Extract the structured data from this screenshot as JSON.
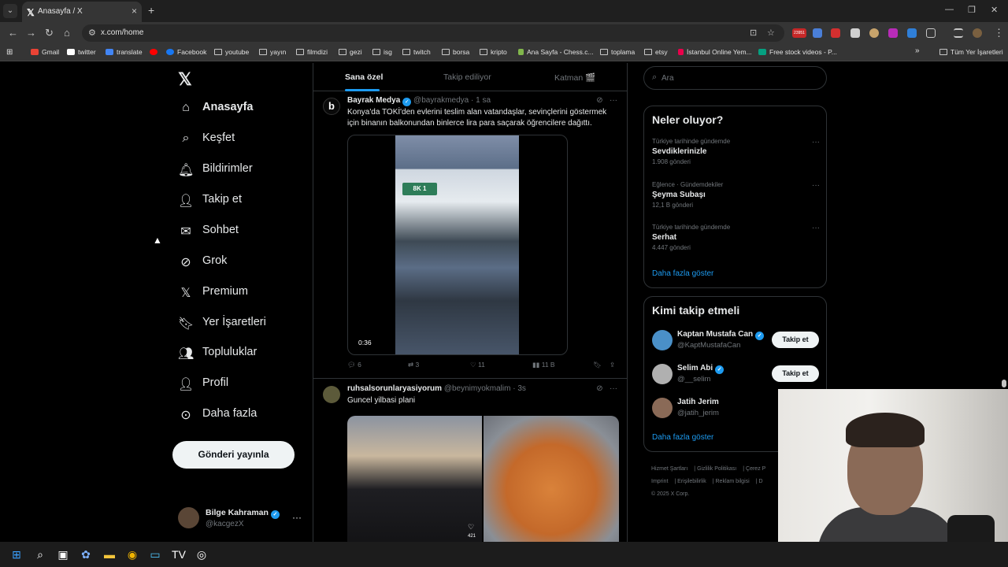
{
  "browser": {
    "tab_title": "Anasayfa / X",
    "url": "x.com/home",
    "bookmarks": [
      {
        "label": "Gmail",
        "icon": "gmail-icon",
        "color": "#ea4335"
      },
      {
        "label": "twitter",
        "icon": "x-icon",
        "color": "#ffffff"
      },
      {
        "label": "translate",
        "icon": "translate-icon",
        "color": "#4285f4"
      },
      {
        "label": "",
        "icon": "youtube-icon",
        "color": "#ff0000"
      },
      {
        "label": "Facebook",
        "icon": "facebook-icon",
        "color": "#1877f2"
      },
      {
        "label": "youtube",
        "icon": "folder-icon",
        "color": ""
      },
      {
        "label": "yayın",
        "icon": "folder-icon",
        "color": ""
      },
      {
        "label": "filmdizi",
        "icon": "folder-icon",
        "color": ""
      },
      {
        "label": "gezi",
        "icon": "folder-icon",
        "color": ""
      },
      {
        "label": "isg",
        "icon": "folder-icon",
        "color": ""
      },
      {
        "label": "twitch",
        "icon": "folder-icon",
        "color": ""
      },
      {
        "label": "borsa",
        "icon": "folder-icon",
        "color": ""
      },
      {
        "label": "kripto",
        "icon": "folder-icon",
        "color": ""
      },
      {
        "label": "Ana Sayfa - Chess.c...",
        "icon": "chess-icon",
        "color": "#81b64c"
      },
      {
        "label": "toplama",
        "icon": "folder-icon",
        "color": ""
      },
      {
        "label": "etsy",
        "icon": "folder-icon",
        "color": ""
      },
      {
        "label": "İstanbul Online Yem...",
        "icon": "yemeksepeti-icon",
        "color": "#ea004b"
      },
      {
        "label": "Free stock videos - P...",
        "icon": "pexels-icon",
        "color": "#05a081"
      }
    ],
    "all_bookmarks": "Tüm Yer İşaretleri",
    "extension_badge": "23951"
  },
  "nav": {
    "items": [
      {
        "label": "Anasayfa",
        "icon": "home-icon"
      },
      {
        "label": "Keşfet",
        "icon": "search-icon"
      },
      {
        "label": "Bildirimler",
        "icon": "bell-icon"
      },
      {
        "label": "Takip et",
        "icon": "follow-icon"
      },
      {
        "label": "Sohbet",
        "icon": "mail-icon"
      },
      {
        "label": "Grok",
        "icon": "grok-icon"
      },
      {
        "label": "Premium",
        "icon": "x-icon"
      },
      {
        "label": "Yer İşaretleri",
        "icon": "bookmark-icon"
      },
      {
        "label": "Topluluklar",
        "icon": "communities-icon"
      },
      {
        "label": "Profil",
        "icon": "profile-icon"
      },
      {
        "label": "Daha fazla",
        "icon": "more-icon"
      }
    ],
    "post_button": "Gönderi yayınla",
    "account": {
      "name": "Bilge Kahraman",
      "handle": "@kacgezX"
    }
  },
  "feed": {
    "tabs": [
      "Sana özel",
      "Takip ediliyor",
      "Katman 🎬"
    ],
    "posts": [
      {
        "author": "Bayrak Medya",
        "handle": "@bayrakmedya",
        "time": "· 1 sa",
        "text": "Konya'da TOKİ'den evlerini teslim alan vatandaşlar, sevinçlerini göstermek için binanın balkonundan binlerce lira para saçarak öğrencilere dağıttı.",
        "video_duration": "0:36",
        "sign_text": "8K 1",
        "replies": "6",
        "reposts": "3",
        "likes": "11",
        "views": "11 B"
      },
      {
        "author": "ruhsalsorunlaryasiyorum",
        "handle": "@beynimyokmalim",
        "time": "· 3s",
        "text": "Guncel yilbasi plani",
        "media_like_count": "421"
      }
    ]
  },
  "sidebar": {
    "search_placeholder": "Ara",
    "trends_title": "Neler oluyor?",
    "trends": [
      {
        "context": "Türkiye tarihinde gündemde",
        "name": "Sevdiklerinizle",
        "posts": "1.908 gönderi"
      },
      {
        "context": "Eğlence · Gündemdekiler",
        "name": "Şeyma Subaşı",
        "posts": "12,1 B gönderi"
      },
      {
        "context": "Türkiye tarihinde gündemde",
        "name": "Serhat",
        "posts": "4.447 gönderi"
      }
    ],
    "trends_more": "Daha fazla göster",
    "who_title": "Kimi takip etmeli",
    "who": [
      {
        "name": "Kaptan Mustafa Can",
        "handle": "@KaptMustafaCan",
        "verified": true,
        "button": "Takip et"
      },
      {
        "name": "Selim Abi",
        "handle": "@__selim",
        "verified": true,
        "button": "Takip et"
      },
      {
        "name": "Jatih Jerim",
        "handle": "@jatih_jerim",
        "verified": false,
        "button": ""
      }
    ],
    "who_more": "Daha fazla göster",
    "footer_links": [
      "Hizmet Şartları",
      "Gizlilik Politikası",
      "Çerez P",
      "Imprint",
      "Erişilebilirlik",
      "Reklam bilgisi",
      "D"
    ],
    "copyright": "© 2025 X Corp."
  }
}
